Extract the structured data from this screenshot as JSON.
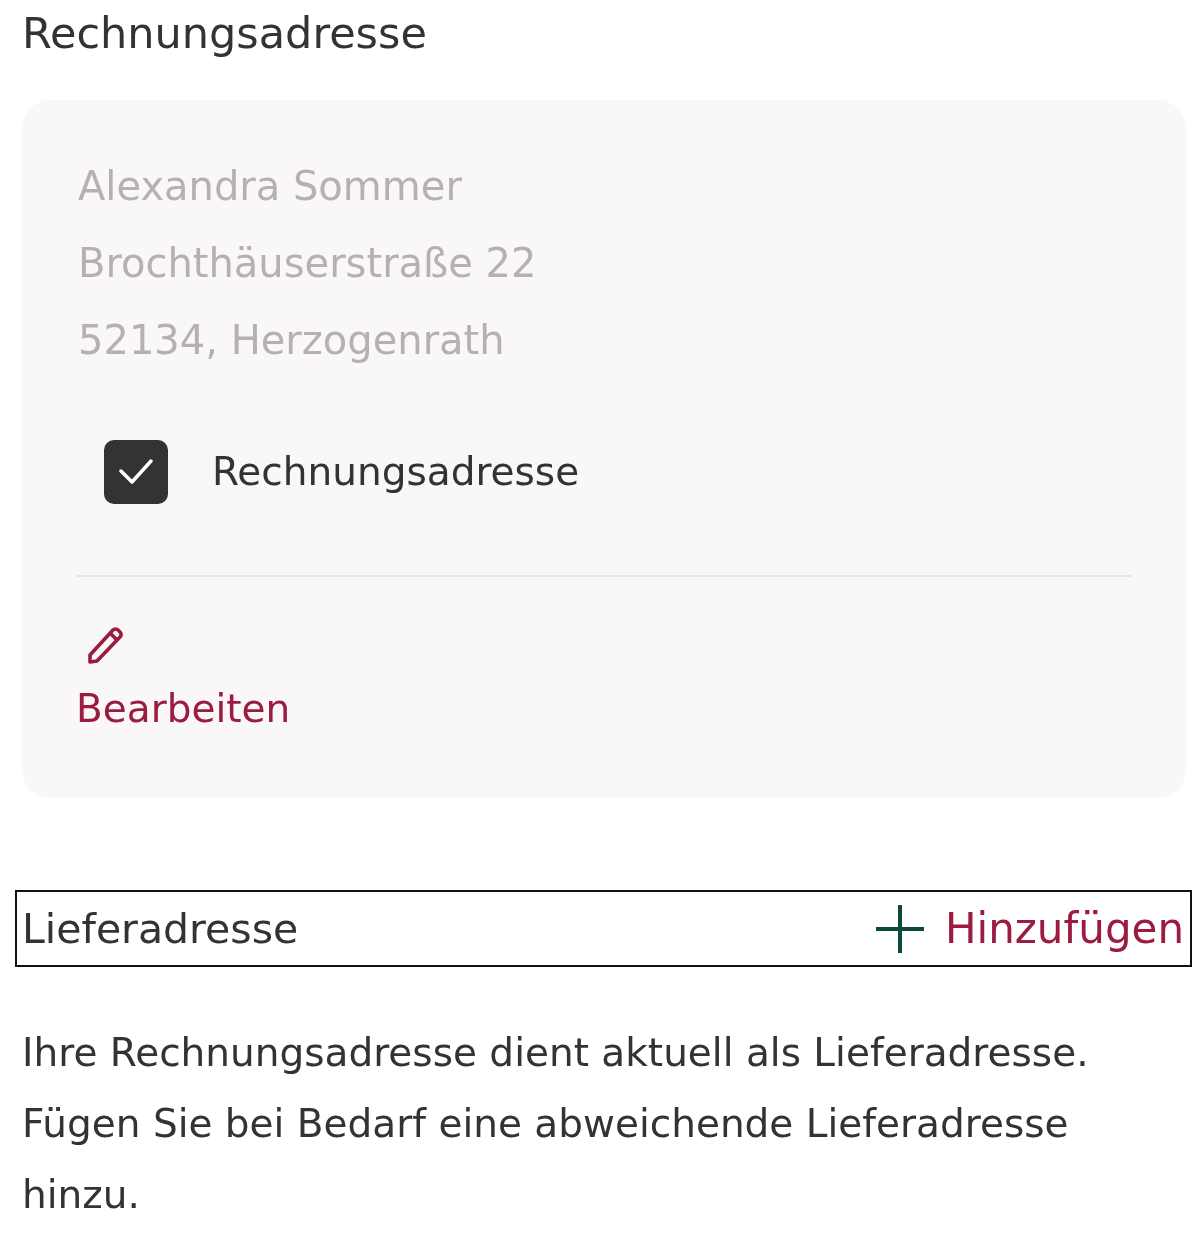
{
  "billing": {
    "title": "Rechnungsadresse",
    "address_lines": [
      "Alexandra Sommer",
      "Brochthäuserstraße 22",
      "52134, Herzogenrath"
    ],
    "checkbox": {
      "label": "Rechnungsadresse",
      "checked": true
    },
    "edit_button": {
      "label": "Bearbeiten"
    }
  },
  "shipping": {
    "title": "Lieferadresse",
    "add_button": {
      "label": "Hinzufügen"
    },
    "note": "Ihre Rechnungsadresse dient aktuell als Lieferadresse. Fügen Sie bei Bedarf eine abweichende Lieferadresse hinzu."
  }
}
